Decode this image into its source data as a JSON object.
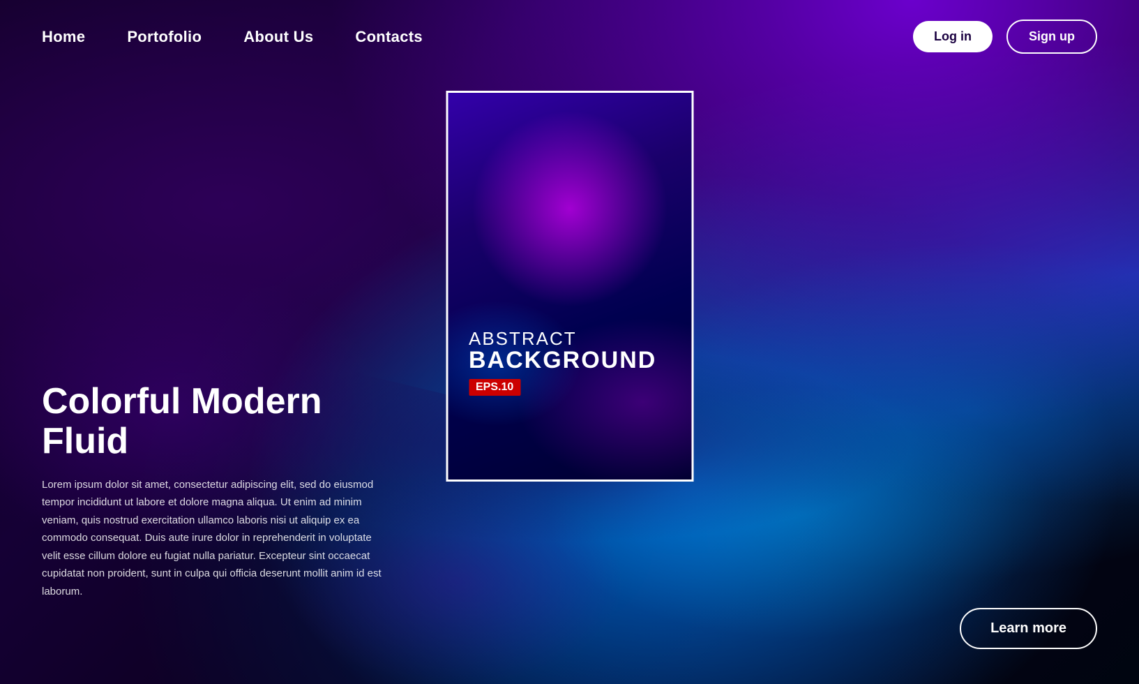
{
  "nav": {
    "links": [
      {
        "id": "home",
        "label": "Home"
      },
      {
        "id": "portfolio",
        "label": "Portofolio"
      },
      {
        "id": "about",
        "label": "About Us"
      },
      {
        "id": "contacts",
        "label": "Contacts"
      }
    ],
    "login_label": "Log in",
    "signup_label": "Sign up"
  },
  "hero": {
    "title": "Colorful Modern Fluid",
    "body": "Lorem ipsum dolor sit amet, consectetur adipiscing elit, sed do eiusmod tempor incididunt ut labore et dolore magna aliqua. Ut enim ad minim veniam, quis nostrud exercitation ullamco laboris nisi ut aliquip ex ea commodo consequat. Duis aute irure dolor in reprehenderit in voluptate velit esse cillum dolore eu fugiat nulla pariatur. Excepteur sint occaecat cupidatat non proident, sunt in culpa qui officia deserunt mollit anim id est laborum."
  },
  "card": {
    "line1": "ABSTRACT",
    "line2": "BACKGROUND",
    "badge": "EPS.10"
  },
  "cta": {
    "learn_more": "Learn more"
  }
}
